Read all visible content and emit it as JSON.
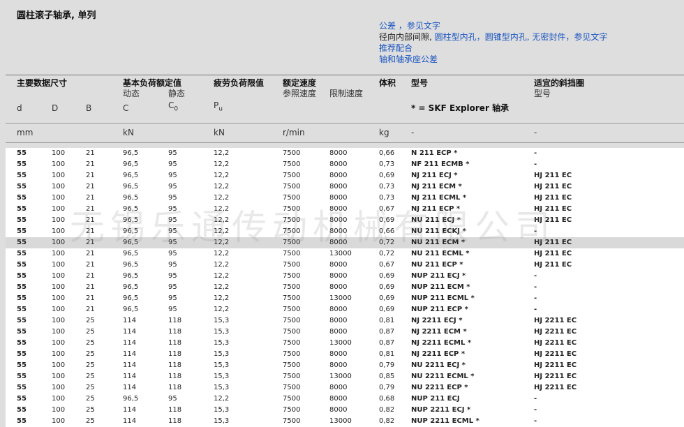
{
  "page": {
    "title": "圆柱滚子轴承, 单列",
    "links": {
      "line1": "公差 ，参见文字",
      "line2_prefix": "径向内部间隙,",
      "line2_a": "圆柱型内孔",
      "line2_sep1": "，",
      "line2_b": "圆锥型内孔, 无密封件",
      "line2_sep2": "，",
      "line2_c": "参见文字",
      "line3": "推荐配合",
      "line4": "轴和轴承座公差"
    }
  },
  "header": {
    "main_dims": "主要数据尺寸",
    "load_ratings": "基本负荷额定值",
    "dynamic": "动态",
    "static": "静态",
    "fatigue": "疲劳负荷限值",
    "speed": "额定速度",
    "ref_speed": "参照速度",
    "limit_speed": "限制速度",
    "mass": "体积",
    "designation": "型号",
    "explorer": "* = SKF Explorer 轴承",
    "ring": "适宜的斜挡圈",
    "ring_sub": "型号",
    "sym_d": "d",
    "sym_D": "D",
    "sym_B": "B",
    "sym_C": "C",
    "sym_C0": "C",
    "sym_C0_sub": "0",
    "sym_Pu": "P",
    "sym_Pu_sub": "u",
    "unit_mm": "mm",
    "unit_kN1": "kN",
    "unit_kN2": "kN",
    "unit_rpm": "r/min",
    "unit_kg": "kg",
    "unit_dash1": "-",
    "unit_dash2": "-"
  },
  "watermark": "无锡乐通传动机械有限公司",
  "rows": [
    [
      "55",
      "100",
      "21",
      "96,5",
      "95",
      "12,2",
      "7500",
      "8000",
      "0,66",
      "N 211 ECP *",
      "-"
    ],
    [
      "55",
      "100",
      "21",
      "96,5",
      "95",
      "12,2",
      "7500",
      "8000",
      "0,73",
      "NF 211 ECMB *",
      "-"
    ],
    [
      "55",
      "100",
      "21",
      "96,5",
      "95",
      "12,2",
      "7500",
      "8000",
      "0,69",
      "NJ 211 ECJ *",
      "HJ 211 EC"
    ],
    [
      "55",
      "100",
      "21",
      "96,5",
      "95",
      "12,2",
      "7500",
      "8000",
      "0,73",
      "NJ 211 ECM *",
      "HJ 211 EC"
    ],
    [
      "55",
      "100",
      "21",
      "96,5",
      "95",
      "12,2",
      "7500",
      "8000",
      "0,73",
      "NJ 211 ECML *",
      "HJ 211 EC"
    ],
    [
      "55",
      "100",
      "21",
      "96,5",
      "95",
      "12,2",
      "7500",
      "8000",
      "0,67",
      "NJ 211 ECP *",
      "HJ 211 EC"
    ],
    [
      "55",
      "100",
      "21",
      "96,5",
      "95",
      "12,2",
      "7500",
      "8000",
      "0,69",
      "NU 211 ECJ *",
      "HJ 211 EC"
    ],
    [
      "55",
      "100",
      "21",
      "96,5",
      "95",
      "12,2",
      "7500",
      "8000",
      "0,66",
      "NU 211 ECKJ *",
      "-"
    ],
    [
      "55",
      "100",
      "21",
      "96,5",
      "95",
      "12,2",
      "7500",
      "8000",
      "0,72",
      "NU 211 ECM *",
      "HJ 211 EC"
    ],
    [
      "55",
      "100",
      "21",
      "96,5",
      "95",
      "12,2",
      "7500",
      "13000",
      "0,72",
      "NU 211 ECML *",
      "HJ 211 EC"
    ],
    [
      "55",
      "100",
      "21",
      "96,5",
      "95",
      "12,2",
      "7500",
      "8000",
      "0,67",
      "NU 211 ECP *",
      "HJ 211 EC"
    ],
    [
      "55",
      "100",
      "21",
      "96,5",
      "95",
      "12,2",
      "7500",
      "8000",
      "0,69",
      "NUP 211 ECJ *",
      "-"
    ],
    [
      "55",
      "100",
      "21",
      "96,5",
      "95",
      "12,2",
      "7500",
      "8000",
      "0,69",
      "NUP 211 ECM *",
      "-"
    ],
    [
      "55",
      "100",
      "21",
      "96,5",
      "95",
      "12,2",
      "7500",
      "13000",
      "0,69",
      "NUP 211 ECML *",
      "-"
    ],
    [
      "55",
      "100",
      "21",
      "96,5",
      "95",
      "12,2",
      "7500",
      "8000",
      "0,69",
      "NUP 211 ECP *",
      "-"
    ],
    [
      "55",
      "100",
      "25",
      "114",
      "118",
      "15,3",
      "7500",
      "8000",
      "0,81",
      "NJ 2211 ECJ *",
      "HJ 2211 EC"
    ],
    [
      "55",
      "100",
      "25",
      "114",
      "118",
      "15,3",
      "7500",
      "8000",
      "0,87",
      "NJ 2211 ECM *",
      "HJ 2211 EC"
    ],
    [
      "55",
      "100",
      "25",
      "114",
      "118",
      "15,3",
      "7500",
      "13000",
      "0,87",
      "NJ 2211 ECML *",
      "HJ 2211 EC"
    ],
    [
      "55",
      "100",
      "25",
      "114",
      "118",
      "15,3",
      "7500",
      "8000",
      "0,81",
      "NJ 2211 ECP *",
      "HJ 2211 EC"
    ],
    [
      "55",
      "100",
      "25",
      "114",
      "118",
      "15,3",
      "7500",
      "8000",
      "0,79",
      "NU 2211 ECJ *",
      "HJ 2211 EC"
    ],
    [
      "55",
      "100",
      "25",
      "114",
      "118",
      "15,3",
      "7500",
      "13000",
      "0,85",
      "NU 2211 ECML *",
      "HJ 2211 EC"
    ],
    [
      "55",
      "100",
      "25",
      "114",
      "118",
      "15,3",
      "7500",
      "8000",
      "0,79",
      "NU 2211 ECP *",
      "HJ 2211 EC"
    ],
    [
      "55",
      "100",
      "25",
      "96,5",
      "95",
      "12,2",
      "7500",
      "8000",
      "0,68",
      "NUP 211 ECJ",
      "-"
    ],
    [
      "55",
      "100",
      "25",
      "114",
      "118",
      "15,3",
      "7500",
      "8000",
      "0,82",
      "NUP 2211 ECJ *",
      "-"
    ],
    [
      "55",
      "100",
      "25",
      "114",
      "118",
      "15,3",
      "7500",
      "13000",
      "0,82",
      "NUP 2211 ECML *",
      "-"
    ]
  ],
  "highlighted_row": 8
}
